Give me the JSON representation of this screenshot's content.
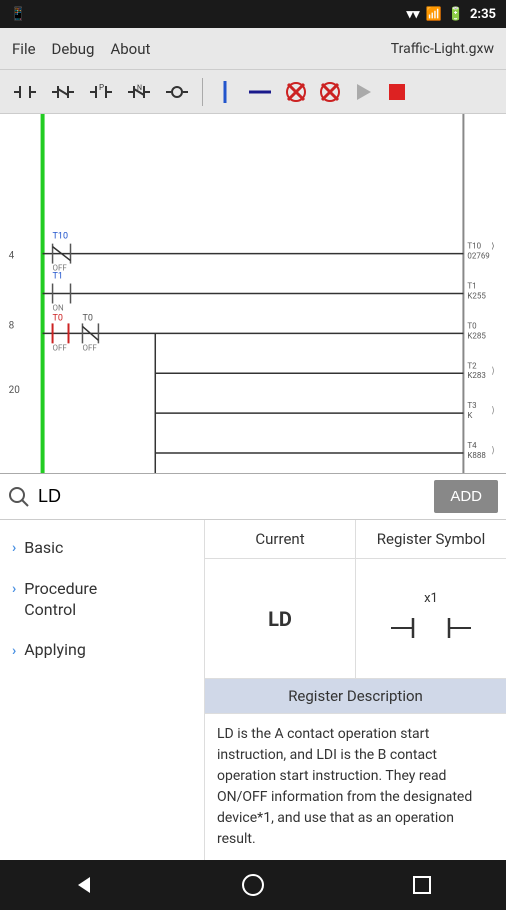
{
  "statusBar": {
    "time": "2:35",
    "icons": [
      "signal",
      "wifi",
      "battery"
    ]
  },
  "menuBar": {
    "items": [
      "File",
      "Debug",
      "About"
    ],
    "title": "Traffic-Light.gxw"
  },
  "toolbar": {
    "buttons": [
      {
        "name": "contact-no",
        "symbol": "⊣⊢",
        "label": "NO Contact"
      },
      {
        "name": "contact-nc",
        "symbol": "⊣/⊢",
        "label": "NC Contact"
      },
      {
        "name": "contact-pos",
        "symbol": "⊣⊢",
        "label": "POS Contact"
      },
      {
        "name": "contact-neg",
        "symbol": "⊣/⊢",
        "label": "NEG Contact"
      },
      {
        "name": "coil",
        "symbol": "( )",
        "label": "Coil"
      },
      {
        "name": "vertical-line",
        "symbol": "|",
        "label": "Vertical Line"
      },
      {
        "name": "horizontal-line",
        "symbol": "—",
        "label": "Horizontal Line"
      },
      {
        "name": "delete-cross",
        "symbol": "✕",
        "label": "Delete"
      },
      {
        "name": "delete-x",
        "symbol": "✕",
        "label": "Delete X"
      },
      {
        "name": "play",
        "symbol": "▶",
        "label": "Run"
      },
      {
        "name": "stop",
        "symbol": "■",
        "label": "Stop"
      }
    ]
  },
  "searchBar": {
    "placeholder": "LD",
    "value": "LD",
    "addButton": "ADD"
  },
  "sidebar": {
    "items": [
      {
        "label": "Basic",
        "id": "basic"
      },
      {
        "label": "Procedure Control",
        "id": "procedure-control"
      },
      {
        "label": "Applying",
        "id": "applying"
      }
    ]
  },
  "registerPanel": {
    "headers": [
      "Current",
      "Register Symbol"
    ],
    "currentValue": "LD",
    "symbolLabel": "x1",
    "descriptionHeader": "Register Description",
    "descriptionText": "LD is the A contact operation start instruction, and LDI is the B contact operation start instruction. They read ON/OFF information from the designated device*1, and use that as an operation result."
  }
}
